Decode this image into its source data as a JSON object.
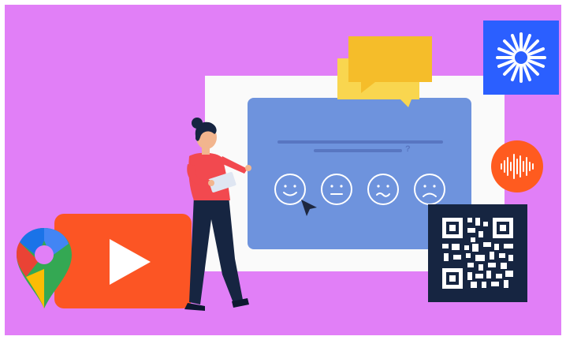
{
  "scene": {
    "colors": {
      "background": "#e17ff7",
      "survey_card": "#fafafa",
      "survey_panel": "#6e93dd",
      "chat_bubble_front": "#f5bd2a",
      "chat_bubble_back": "#f9d64f",
      "video_player": "#fc5524",
      "asterisk_tile": "#2b5fff",
      "audio_circle": "#ff5b1f",
      "qr_tile": "#162541"
    },
    "survey": {
      "question_mark": "?",
      "rating_faces": [
        "happy-face-icon",
        "neutral-face-icon",
        "unsure-face-icon",
        "sad-face-icon"
      ]
    },
    "icons": [
      "chat-bubbles-icon",
      "asterisk-logo-icon",
      "audio-wave-icon",
      "qr-code-icon",
      "play-icon",
      "map-pin-icon",
      "cursor-icon",
      "person-illustration"
    ]
  }
}
